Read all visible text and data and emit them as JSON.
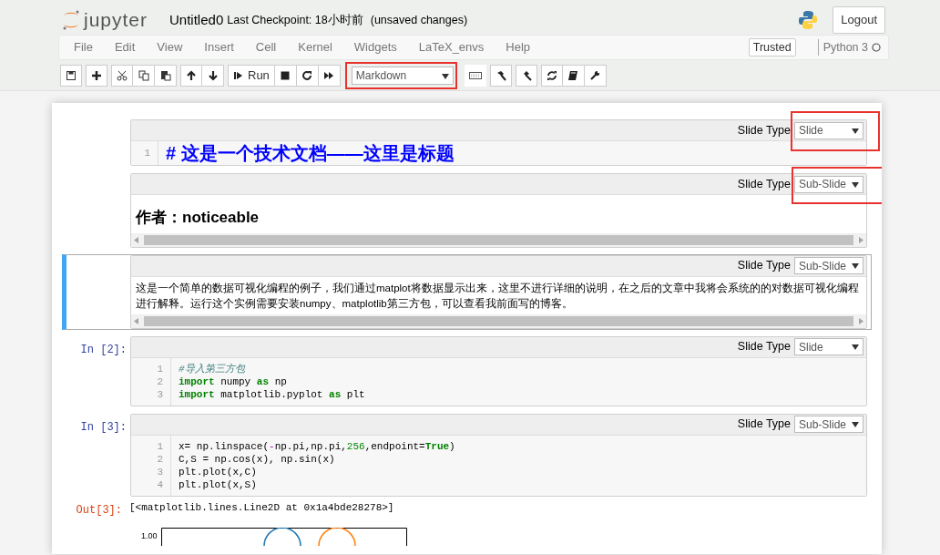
{
  "header": {
    "logo": "jupyter",
    "notebook_name": "Untitled0",
    "checkpoint": "Last Checkpoint: 18小时前",
    "autosave": "(unsaved changes)",
    "logout": "Logout"
  },
  "menu": {
    "items": [
      "File",
      "Edit",
      "View",
      "Insert",
      "Cell",
      "Kernel",
      "Widgets",
      "LaTeX_envs",
      "Help"
    ],
    "trusted": "Trusted",
    "kernel": "Python 3",
    "kernel_busy": false
  },
  "toolbar": {
    "run_label": "Run",
    "cell_type": "Markdown",
    "highlighted": true
  },
  "cells": [
    {
      "kind": "markdown_edit",
      "selected": false,
      "slide_type_label": "Slide Type",
      "slide_type": "Slide",
      "highlighted": true,
      "lines": [
        {
          "no": "1",
          "tokens": [
            {
              "t": "# 这是一个技术文档——这里是标题",
              "kind": "heading"
            }
          ]
        }
      ]
    },
    {
      "kind": "markdown",
      "selected": false,
      "slide_type_label": "Slide Type",
      "slide_type": "Sub-Slide",
      "highlighted": true,
      "content": {
        "kind": "heading",
        "text": "作者：noticeable"
      }
    },
    {
      "kind": "markdown",
      "selected": true,
      "slide_type_label": "Slide Type",
      "slide_type": "Sub-Slide",
      "highlighted": false,
      "content": {
        "kind": "paragraph",
        "text": "这是一个简单的数据可视化编程的例子，我们通过matplot将数据显示出来，这里不进行详细的说明，在之后的文章中我将会系统的的对数据可视化编程进行解释。运行这个实例需要安装numpy、matplotlib第三方包，可以查看我前面写的博客。"
      }
    },
    {
      "kind": "code",
      "selected": false,
      "prompt": "In [2]:",
      "slide_type_label": "Slide Type",
      "slide_type": "Slide",
      "highlighted": false,
      "lines": [
        {
          "no": "1",
          "tokens": [
            {
              "t": "#导入第三方包",
              "kind": "comment"
            }
          ]
        },
        {
          "no": "2",
          "tokens": [
            {
              "t": "import",
              "kind": "keyword"
            },
            {
              "t": " numpy ",
              "kind": "plain"
            },
            {
              "t": "as",
              "kind": "keyword"
            },
            {
              "t": " np",
              "kind": "plain"
            }
          ]
        },
        {
          "no": "3",
          "tokens": [
            {
              "t": "import",
              "kind": "keyword"
            },
            {
              "t": " matplotlib.pyplot ",
              "kind": "plain"
            },
            {
              "t": "as",
              "kind": "keyword"
            },
            {
              "t": " plt",
              "kind": "plain"
            }
          ]
        }
      ]
    },
    {
      "kind": "code",
      "selected": false,
      "prompt": "In [3]:",
      "slide_type_label": "Slide Type",
      "slide_type": "Sub-Slide",
      "highlighted": false,
      "lines": [
        {
          "no": "1",
          "tokens": [
            {
              "t": "x= np.linspace(",
              "kind": "plain"
            },
            {
              "t": "-",
              "kind": "operator"
            },
            {
              "t": "np.pi,np.pi,",
              "kind": "plain"
            },
            {
              "t": "256",
              "kind": "number"
            },
            {
              "t": ",endpoint=",
              "kind": "plain"
            },
            {
              "t": "True",
              "kind": "keyword"
            },
            {
              "t": ")",
              "kind": "plain"
            }
          ]
        },
        {
          "no": "2",
          "tokens": [
            {
              "t": "C,S = np.cos(x), np.sin(x)",
              "kind": "plain"
            }
          ]
        },
        {
          "no": "3",
          "tokens": [
            {
              "t": "plt.plot(x,C)",
              "kind": "plain"
            }
          ]
        },
        {
          "no": "4",
          "tokens": [
            {
              "t": "plt.plot(x,S)",
              "kind": "plain"
            }
          ]
        }
      ],
      "output": {
        "prompt": "Out[3]:",
        "text": "[<matplotlib.lines.Line2D at 0x1a4bde28278>]",
        "tick_label": "1.00"
      }
    }
  ]
}
